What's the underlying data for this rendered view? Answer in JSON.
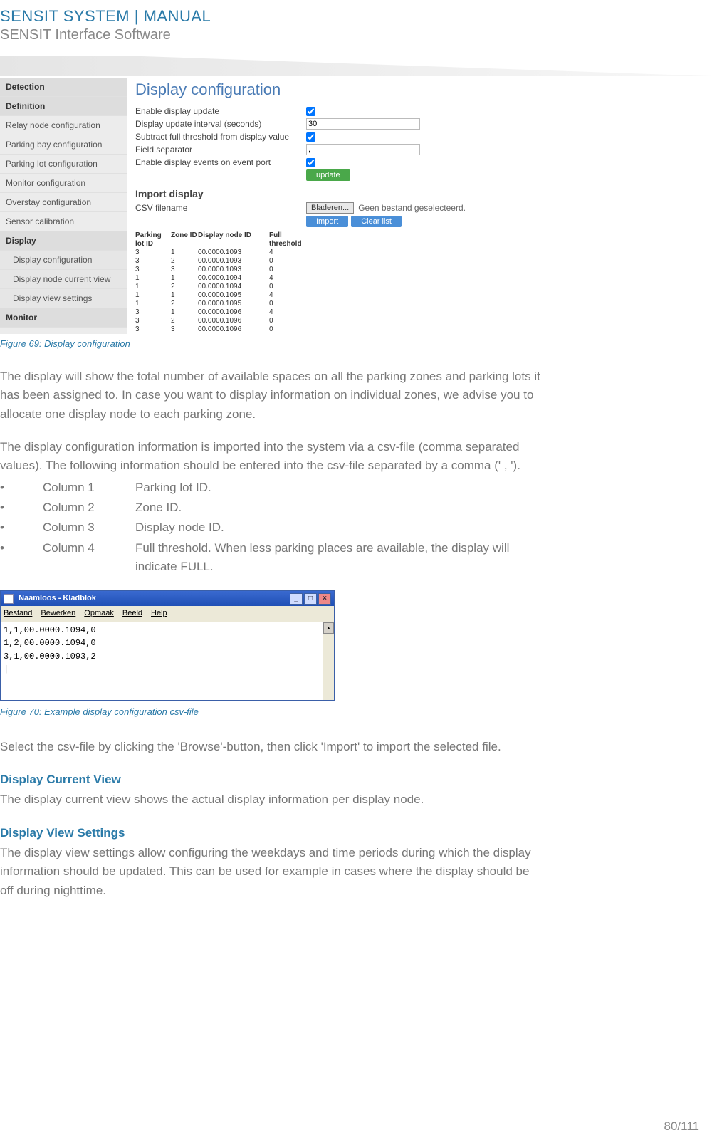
{
  "header": {
    "title": "SENSIT SYSTEM | MANUAL",
    "subtitle": "SENSIT Interface Software"
  },
  "fig69": {
    "sidebar": [
      {
        "label": "Detection",
        "type": "header"
      },
      {
        "label": "Definition",
        "type": "header"
      },
      {
        "label": "Relay node configuration",
        "type": "item"
      },
      {
        "label": "Parking bay configuration",
        "type": "item"
      },
      {
        "label": "Parking lot configuration",
        "type": "item"
      },
      {
        "label": "Monitor configuration",
        "type": "item"
      },
      {
        "label": "Overstay configuration",
        "type": "item"
      },
      {
        "label": "Sensor calibration",
        "type": "item"
      },
      {
        "label": "Display",
        "type": "header"
      },
      {
        "label": "Display configuration",
        "type": "sub"
      },
      {
        "label": "Display node current view",
        "type": "sub"
      },
      {
        "label": "Display view settings",
        "type": "sub"
      },
      {
        "label": "Monitor",
        "type": "header"
      }
    ],
    "title": "Display configuration",
    "rows": {
      "r1": "Enable display update",
      "r2": "Display update interval (seconds)",
      "r2val": "30",
      "r3": "Subtract full threshold from display value",
      "r4": "Field separator",
      "r4val": ",",
      "r5": "Enable display events on event port",
      "update": "update"
    },
    "import": {
      "title": "Import display",
      "csvlabel": "CSV filename",
      "browse": "Bladeren...",
      "nofile": "Geen bestand geselecteerd.",
      "importBtn": "Import",
      "clearBtn": "Clear list"
    },
    "table": {
      "headers": [
        "Parking lot ID",
        "Zone ID",
        "Display node ID",
        "Full threshold"
      ],
      "rows": [
        [
          "3",
          "1",
          "00.0000.1093",
          "4"
        ],
        [
          "3",
          "2",
          "00.0000.1093",
          "0"
        ],
        [
          "3",
          "3",
          "00.0000.1093",
          "0"
        ],
        [
          "1",
          "1",
          "00.0000.1094",
          "4"
        ],
        [
          "1",
          "2",
          "00.0000.1094",
          "0"
        ],
        [
          "1",
          "1",
          "00.0000.1095",
          "4"
        ],
        [
          "1",
          "2",
          "00.0000.1095",
          "0"
        ],
        [
          "3",
          "1",
          "00.0000.1096",
          "4"
        ],
        [
          "3",
          "2",
          "00.0000.1096",
          "0"
        ],
        [
          "3",
          "3",
          "00.0000.1096",
          "0"
        ]
      ]
    },
    "caption": "Figure 69: Display configuration"
  },
  "body": {
    "p1": "The display will show the total number of available spaces on all the parking zones and parking lots it has been assigned to. In case you want to display information on individual zones, we advise you to allocate one display node to each parking zone.",
    "p2": "The display configuration information is imported into the system via a csv-file (comma separated values). The following information should be entered into the csv-file separated by a comma (' , ').",
    "cols": [
      {
        "name": "Column 1",
        "desc": "Parking lot ID."
      },
      {
        "name": "Column 2",
        "desc": "Zone ID."
      },
      {
        "name": "Column 3",
        "desc": "Display node ID."
      },
      {
        "name": "Column 4",
        "desc": "Full threshold. When less parking places are available, the display will indicate FULL."
      }
    ],
    "p3": "Select the csv-file by clicking the 'Browse'-button, then click 'Import' to import the selected file.",
    "h1": "Display Current View",
    "p4": "The display current view shows the actual display information per display node.",
    "h2": "Display View Settings",
    "p5": "The display view settings allow configuring the weekdays and time periods during which the display information should be updated. This can be used for example in cases where the display should be off during nighttime."
  },
  "notepad": {
    "title": "Naamloos - Kladblok",
    "menu": [
      "Bestand",
      "Bewerken",
      "Opmaak",
      "Beeld",
      "Help"
    ],
    "content": "1,1,00.0000.1094,0\n1,2,00.0000.1094,0\n3,1,00.0000.1093,2\n|",
    "caption": "Figure 70: Example display configuration csv-file"
  },
  "pageNum": "80/111"
}
